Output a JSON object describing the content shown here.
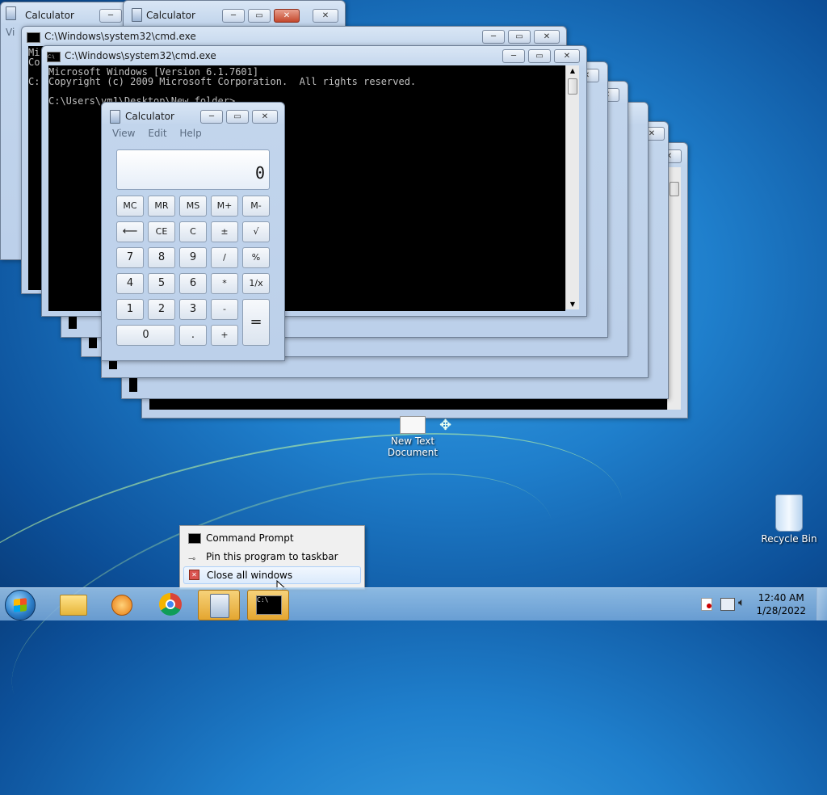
{
  "windows": {
    "calc_back1_title": "Calculator",
    "calc_back2_title": "Calculator",
    "cmd_back_title": "C:\\Windows\\system32\\cmd.exe",
    "cmd_front_title": "C:\\Windows\\system32\\cmd.exe",
    "back_console_lines": "Mi\nCo\n\nC:",
    "back_calc_menu_fragment": "Vi",
    "front_console_lines": "Microsoft Windows [Version 6.1.7601]\nCopyright (c) 2009 Microsoft Corporation.  All rights reserved.\n\nC:\\Users\\vm1\\Desktop\\New folder>"
  },
  "calculator": {
    "title": "Calculator",
    "menu": [
      "View",
      "Edit",
      "Help"
    ],
    "display": "0",
    "keys": {
      "mc": "MC",
      "mr": "MR",
      "ms": "MS",
      "mplus": "M+",
      "mminus": "M-",
      "back": "⟵",
      "ce": "CE",
      "c": "C",
      "pm": "±",
      "sqrt": "√",
      "seven": "7",
      "eight": "8",
      "nine": "9",
      "div": "/",
      "pct": "%",
      "four": "4",
      "five": "5",
      "six": "6",
      "mul": "*",
      "inv": "1/x",
      "one": "1",
      "two": "2",
      "three": "3",
      "sub": "-",
      "eq": "=",
      "zero": "0",
      "dot": ".",
      "add": "+"
    }
  },
  "desktop": {
    "new_text_doc": "New Text Document",
    "recycle_bin": "Recycle Bin"
  },
  "context_menu": {
    "item1": "Command Prompt",
    "item2": "Pin this program to taskbar",
    "item3": "Close all windows"
  },
  "taskbar": {
    "time": "12:40 AM",
    "date": "1/28/2022"
  },
  "controls": {
    "min": "─",
    "max": "▭",
    "close": "✕"
  }
}
